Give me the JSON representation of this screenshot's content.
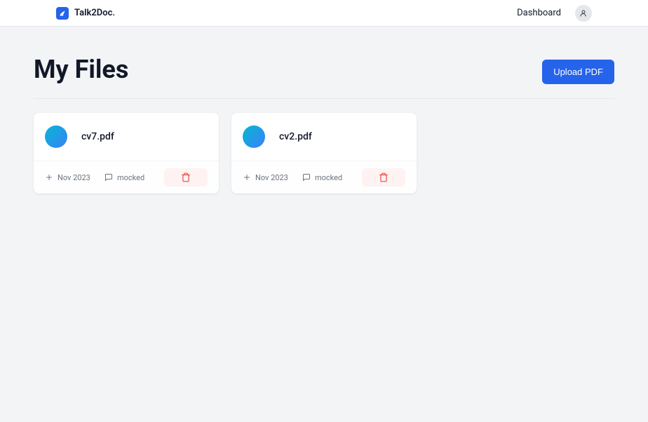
{
  "navbar": {
    "brand": "Talk2Doc.",
    "dashboard_link": "Dashboard"
  },
  "header": {
    "title": "My Files",
    "upload_label": "Upload PDF"
  },
  "files": [
    {
      "name": "cv7.pdf",
      "date": "Nov 2023",
      "comment": "mocked"
    },
    {
      "name": "cv2.pdf",
      "date": "Nov 2023",
      "comment": "mocked"
    }
  ]
}
